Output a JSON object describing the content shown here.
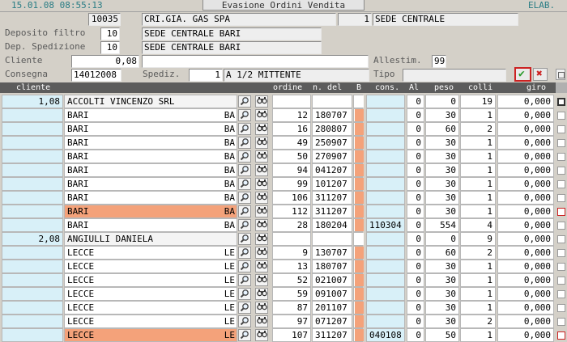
{
  "header": {
    "datetime": "15.01.08 08:55:13",
    "title": "Evasione Ordini Vendita",
    "elab": "ELAB.",
    "code": "10035",
    "company": "CRI.GIA. GAS SPA",
    "site_num": "1",
    "site_name": "SEDE CENTRALE"
  },
  "form": {
    "deposito_label": "Deposito filtro",
    "deposito_value": "10",
    "deposito_name": "SEDE CENTRALE BARI",
    "spedizione_label": "Dep. Spedizione",
    "spedizione_value": "10",
    "spedizione_name": "SEDE CENTRALE BARI",
    "cliente_label": "Cliente",
    "cliente_value": "0,08",
    "allestim_label": "Allestim.",
    "allestim_value": "99",
    "consegna_label": "Consegna",
    "consegna_value": "14012008",
    "spediz_label": "Spediz.",
    "spediz_value": "1",
    "spediz_name": "A 1/2 MITTENTE",
    "tipo_label": "Tipo"
  },
  "grid": {
    "headers": {
      "cliente": "cliente",
      "ordine": "ordine",
      "ndel": "n. del",
      "b": "B",
      "cons": "cons.",
      "al": "Al",
      "peso": "peso",
      "colli": "colli",
      "giro": "giro"
    },
    "rows": [
      {
        "type": "group",
        "cliente": "1,08",
        "desc": "ACCOLTI VINCENZO SRL",
        "prov": "",
        "ordine": "",
        "del": "",
        "cons": "",
        "al": "0",
        "peso": "0",
        "colli": "19",
        "giro": "0,000",
        "hl": false,
        "chk": "dark"
      },
      {
        "type": "item",
        "cliente": "",
        "desc": "BARI",
        "prov": "BA",
        "ordine": "12",
        "del": "180707",
        "cons": "",
        "al": "0",
        "peso": "30",
        "colli": "1",
        "giro": "0,000",
        "hl": false,
        "chk": "normal"
      },
      {
        "type": "item",
        "cliente": "",
        "desc": "BARI",
        "prov": "BA",
        "ordine": "16",
        "del": "280807",
        "cons": "",
        "al": "0",
        "peso": "60",
        "colli": "2",
        "giro": "0,000",
        "hl": false,
        "chk": "normal"
      },
      {
        "type": "item",
        "cliente": "",
        "desc": "BARI",
        "prov": "BA",
        "ordine": "49",
        "del": "250907",
        "cons": "",
        "al": "0",
        "peso": "30",
        "colli": "1",
        "giro": "0,000",
        "hl": false,
        "chk": "normal"
      },
      {
        "type": "item",
        "cliente": "",
        "desc": "BARI",
        "prov": "BA",
        "ordine": "50",
        "del": "270907",
        "cons": "",
        "al": "0",
        "peso": "30",
        "colli": "1",
        "giro": "0,000",
        "hl": false,
        "chk": "normal"
      },
      {
        "type": "item",
        "cliente": "",
        "desc": "BARI",
        "prov": "BA",
        "ordine": "94",
        "del": "041207",
        "cons": "",
        "al": "0",
        "peso": "30",
        "colli": "1",
        "giro": "0,000",
        "hl": false,
        "chk": "normal"
      },
      {
        "type": "item",
        "cliente": "",
        "desc": "BARI",
        "prov": "BA",
        "ordine": "99",
        "del": "101207",
        "cons": "",
        "al": "0",
        "peso": "30",
        "colli": "1",
        "giro": "0,000",
        "hl": false,
        "chk": "normal"
      },
      {
        "type": "item",
        "cliente": "",
        "desc": "BARI",
        "prov": "BA",
        "ordine": "106",
        "del": "311207",
        "cons": "",
        "al": "0",
        "peso": "30",
        "colli": "1",
        "giro": "0,000",
        "hl": false,
        "chk": "normal"
      },
      {
        "type": "item",
        "cliente": "",
        "desc": "BARI",
        "prov": "BA",
        "ordine": "112",
        "del": "311207",
        "cons": "",
        "al": "0",
        "peso": "30",
        "colli": "1",
        "giro": "0,000",
        "hl": true,
        "chk": "red"
      },
      {
        "type": "item",
        "cliente": "",
        "desc": "BARI",
        "prov": "BA",
        "ordine": "28",
        "del": "180204",
        "cons": "110304",
        "al": "0",
        "peso": "554",
        "colli": "4",
        "giro": "0,000",
        "hl": false,
        "chk": "normal"
      },
      {
        "type": "group",
        "cliente": "2,08",
        "desc": "ANGIULLI DANIELA",
        "prov": "",
        "ordine": "",
        "del": "",
        "cons": "",
        "al": "0",
        "peso": "0",
        "colli": "9",
        "giro": "0,000",
        "hl": false,
        "chk": "normal"
      },
      {
        "type": "item",
        "cliente": "",
        "desc": "LECCE",
        "prov": "LE",
        "ordine": "9",
        "del": "130707",
        "cons": "",
        "al": "0",
        "peso": "60",
        "colli": "2",
        "giro": "0,000",
        "hl": false,
        "chk": "normal"
      },
      {
        "type": "item",
        "cliente": "",
        "desc": "LECCE",
        "prov": "LE",
        "ordine": "13",
        "del": "180707",
        "cons": "",
        "al": "0",
        "peso": "30",
        "colli": "1",
        "giro": "0,000",
        "hl": false,
        "chk": "normal"
      },
      {
        "type": "item",
        "cliente": "",
        "desc": "LECCE",
        "prov": "LE",
        "ordine": "52",
        "del": "021007",
        "cons": "",
        "al": "0",
        "peso": "30",
        "colli": "1",
        "giro": "0,000",
        "hl": false,
        "chk": "normal"
      },
      {
        "type": "item",
        "cliente": "",
        "desc": "LECCE",
        "prov": "LE",
        "ordine": "59",
        "del": "091007",
        "cons": "",
        "al": "0",
        "peso": "30",
        "colli": "1",
        "giro": "0,000",
        "hl": false,
        "chk": "normal"
      },
      {
        "type": "item",
        "cliente": "",
        "desc": "LECCE",
        "prov": "LE",
        "ordine": "87",
        "del": "201107",
        "cons": "",
        "al": "0",
        "peso": "30",
        "colli": "1",
        "giro": "0,000",
        "hl": false,
        "chk": "normal"
      },
      {
        "type": "item",
        "cliente": "",
        "desc": "LECCE",
        "prov": "LE",
        "ordine": "97",
        "del": "071207",
        "cons": "",
        "al": "0",
        "peso": "30",
        "colli": "2",
        "giro": "0,000",
        "hl": false,
        "chk": "normal"
      },
      {
        "type": "item",
        "cliente": "",
        "desc": "LECCE",
        "prov": "LE",
        "ordine": "107",
        "del": "311207",
        "cons": "040108",
        "al": "0",
        "peso": "50",
        "colli": "1",
        "giro": "0,000",
        "hl": true,
        "chk": "red"
      }
    ]
  },
  "icons": {
    "search": "magnifier-icon",
    "binoculars": "binoculars-icon",
    "confirm": "check-icon",
    "cancel": "x-icon",
    "print": "print-icon"
  },
  "colors": {
    "highlight": "#f4a27a",
    "client_cell": "#d8f0f8",
    "teal_text": "#2a7d85"
  }
}
